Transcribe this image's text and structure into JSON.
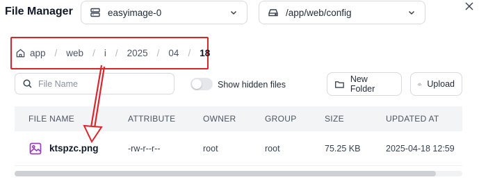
{
  "app": {
    "title": "File Manager"
  },
  "server_select": {
    "value": "easyimage-0"
  },
  "path_select": {
    "value": "/app/web/config"
  },
  "breadcrumb": {
    "items": [
      "app",
      "web",
      "i",
      "2025",
      "04",
      "18"
    ]
  },
  "search": {
    "placeholder": "File Name",
    "value": ""
  },
  "hidden_files_toggle": {
    "label": "Show hidden files",
    "on": false
  },
  "toolbar": {
    "new_folder_label": "New Folder",
    "upload_label": "Upload"
  },
  "table": {
    "headers": [
      "FILE NAME",
      "ATTRIBUTE",
      "OWNER",
      "GROUP",
      "SIZE",
      "UPDATED AT"
    ],
    "rows": [
      {
        "name": "ktspzc.png",
        "icon": "image-file-icon",
        "attribute": "-rw-r--r--",
        "owner": "root",
        "group": "root",
        "size": "75.25 KB",
        "updated_at": "2025-04-18 12:59"
      }
    ]
  },
  "annotation": {
    "highlight_color": "#d9252b"
  },
  "colors": {
    "accent": "#9b3fb5",
    "border": "#d6d9de",
    "header_bg": "#f3f4f6"
  }
}
